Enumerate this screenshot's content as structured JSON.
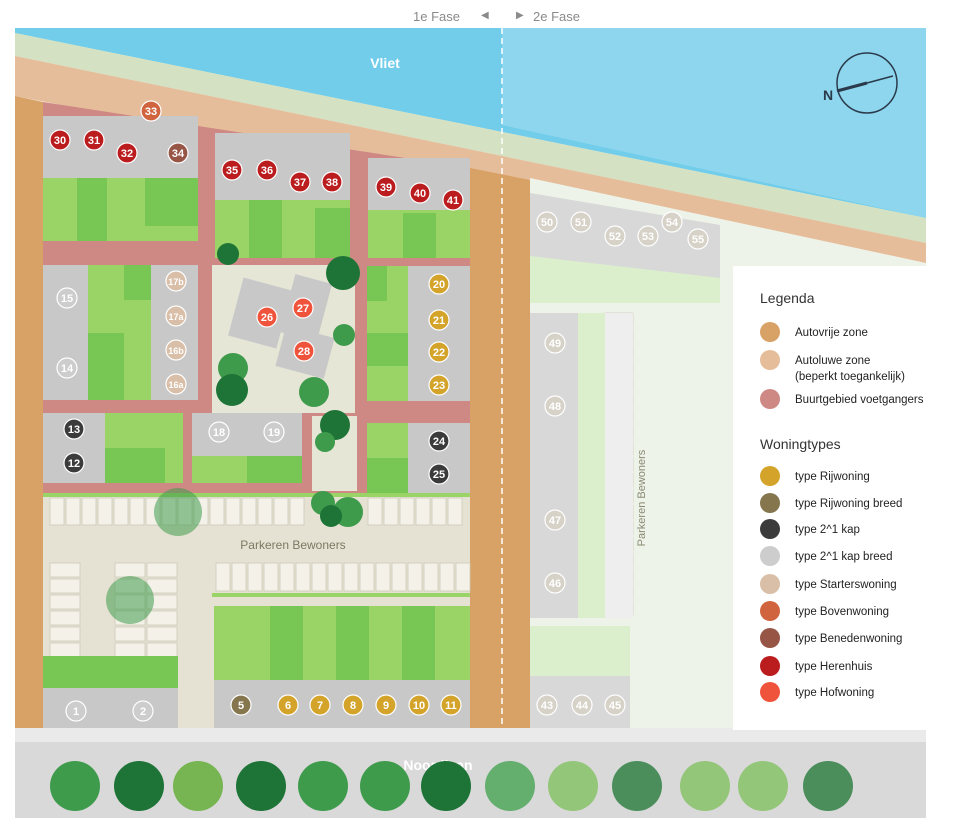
{
  "phases": {
    "phase1": "1e Fase",
    "phase2": "2e Fase"
  },
  "labels": {
    "water": "Vliet",
    "street": "Noordlaan",
    "parking": "Parkeren Bewoners",
    "side_parking": "Parkeren Bewoners",
    "north": "N"
  },
  "legend": {
    "title": "Legenda",
    "zones": [
      {
        "label": "Autovrije zone",
        "color": "#d8a165"
      },
      {
        "label": "Autoluwe zone",
        "label2": "(beperkt toegankelijk)",
        "color": "#e6bd9a"
      },
      {
        "label": "Buurtgebied voetgangers",
        "color": "#cf8985"
      }
    ],
    "types_title": "Woningtypes",
    "types": [
      {
        "label": "type Rijwoning",
        "color": "#d4a32a"
      },
      {
        "label": "type Rijwoning breed",
        "color": "#85764e"
      },
      {
        "label": "type 2^1 kap",
        "color": "#3b3b3b"
      },
      {
        "label": "type 2^1 kap breed",
        "color": "#cdcdcd"
      },
      {
        "label": "type Starterswoning",
        "color": "#d9bfa8"
      },
      {
        "label": "type Bovenwoning",
        "color": "#d0643e"
      },
      {
        "label": "type Benedenwoning",
        "color": "#975546"
      },
      {
        "label": "type Herenhuis",
        "color": "#bb1c1e"
      },
      {
        "label": "type Hofwoning",
        "color": "#f0533b"
      }
    ]
  },
  "houses": [
    {
      "n": "30",
      "t": "herenhuis"
    },
    {
      "n": "31",
      "t": "herenhuis"
    },
    {
      "n": "32",
      "t": "herenhuis"
    },
    {
      "n": "33",
      "t": "bovenwoning"
    },
    {
      "n": "34",
      "t": "benedenwoning"
    },
    {
      "n": "35",
      "t": "herenhuis"
    },
    {
      "n": "36",
      "t": "herenhuis"
    },
    {
      "n": "37",
      "t": "herenhuis"
    },
    {
      "n": "38",
      "t": "herenhuis"
    },
    {
      "n": "39",
      "t": "herenhuis"
    },
    {
      "n": "40",
      "t": "herenhuis"
    },
    {
      "n": "41",
      "t": "herenhuis"
    },
    {
      "n": "15",
      "t": "kap_breed"
    },
    {
      "n": "14",
      "t": "kap_breed"
    },
    {
      "n": "17b",
      "t": "starter"
    },
    {
      "n": "17a",
      "t": "starter"
    },
    {
      "n": "16b",
      "t": "starter"
    },
    {
      "n": "16a",
      "t": "starter"
    },
    {
      "n": "26",
      "t": "hofwoning"
    },
    {
      "n": "27",
      "t": "hofwoning"
    },
    {
      "n": "28",
      "t": "hofwoning"
    },
    {
      "n": "20",
      "t": "rijwoning"
    },
    {
      "n": "21",
      "t": "rijwoning"
    },
    {
      "n": "22",
      "t": "rijwoning"
    },
    {
      "n": "23",
      "t": "rijwoning"
    },
    {
      "n": "13",
      "t": "kap"
    },
    {
      "n": "12",
      "t": "kap"
    },
    {
      "n": "18",
      "t": "kap_breed"
    },
    {
      "n": "19",
      "t": "kap_breed"
    },
    {
      "n": "24",
      "t": "kap"
    },
    {
      "n": "25",
      "t": "kap"
    },
    {
      "n": "1",
      "t": "kap_breed"
    },
    {
      "n": "2",
      "t": "kap_breed"
    },
    {
      "n": "5",
      "t": "rijwoning_breed"
    },
    {
      "n": "6",
      "t": "rijwoning"
    },
    {
      "n": "7",
      "t": "rijwoning"
    },
    {
      "n": "8",
      "t": "rijwoning"
    },
    {
      "n": "9",
      "t": "rijwoning"
    },
    {
      "n": "10",
      "t": "rijwoning"
    },
    {
      "n": "11",
      "t": "rijwoning"
    },
    {
      "n": "50",
      "t": "phase2"
    },
    {
      "n": "51",
      "t": "phase2"
    },
    {
      "n": "52",
      "t": "phase2"
    },
    {
      "n": "53",
      "t": "phase2"
    },
    {
      "n": "54",
      "t": "phase2"
    },
    {
      "n": "55",
      "t": "phase2"
    },
    {
      "n": "49",
      "t": "phase2"
    },
    {
      "n": "48",
      "t": "phase2"
    },
    {
      "n": "47",
      "t": "phase2"
    },
    {
      "n": "46",
      "t": "phase2"
    },
    {
      "n": "43",
      "t": "phase2"
    },
    {
      "n": "44",
      "t": "phase2"
    },
    {
      "n": "45",
      "t": "phase2"
    }
  ],
  "type_colors": {
    "herenhuis": "#bb1c1e",
    "bovenwoning": "#d0643e",
    "benedenwoning": "#975546",
    "kap_breed": "#cdcdcd",
    "starter": "#d9bfa8",
    "hofwoning": "#f0533b",
    "rijwoning": "#d4a32a",
    "rijwoning_breed": "#85764e",
    "kap": "#3b3b3b",
    "phase2": "#d7d2c7"
  }
}
